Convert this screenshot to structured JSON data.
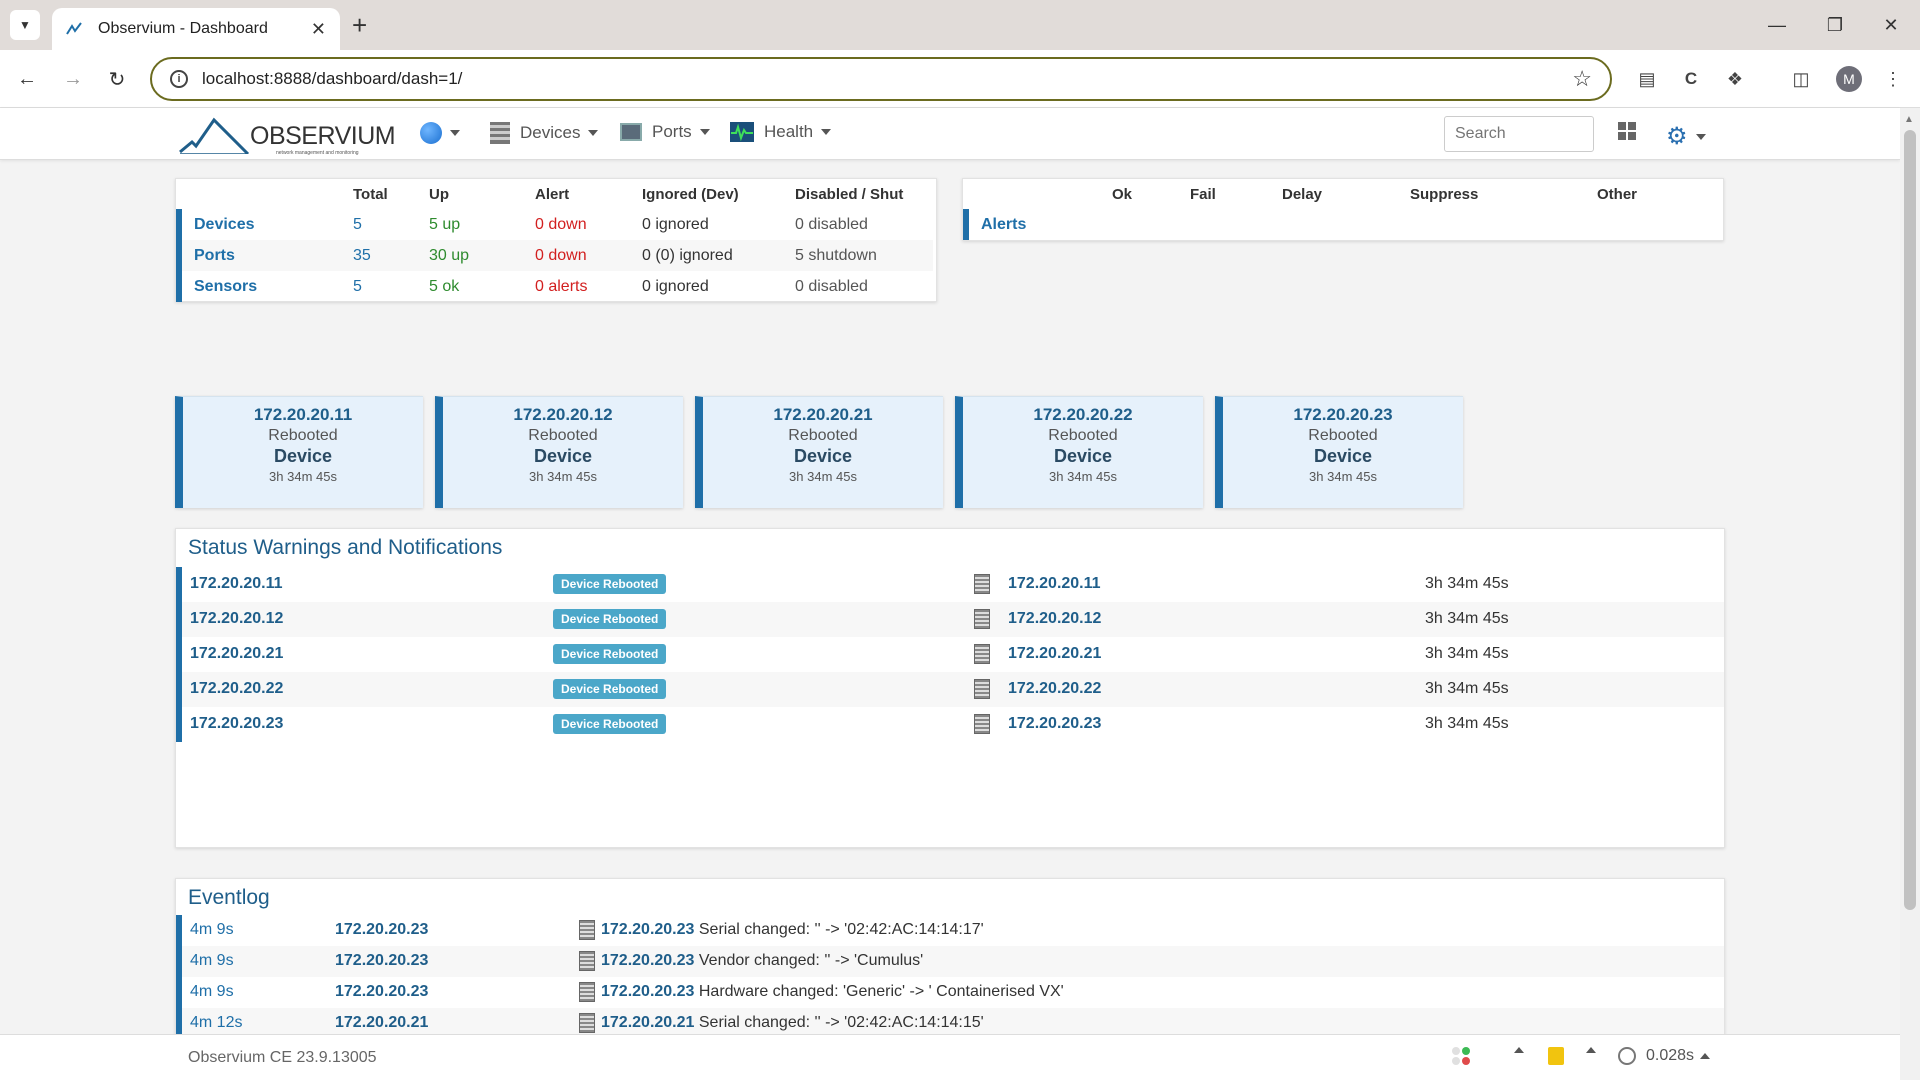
{
  "browser": {
    "tab_title": "Observium - Dashboard",
    "url": "localhost:8888/dashboard/dash=1/",
    "avatar_letter": "M"
  },
  "nav": {
    "logo_text": "OBSERVIUM",
    "logo_tagline": "network management and monitoring",
    "devices": "Devices",
    "ports": "Ports",
    "health": "Health",
    "search_placeholder": "Search"
  },
  "status_summary": {
    "headers": [
      "",
      "Total",
      "Up",
      "Alert",
      "Ignored (Dev)",
      "Disabled / Shut"
    ],
    "rows": [
      {
        "label": "Devices",
        "total": "5",
        "up": "5 up",
        "alert": "0 down",
        "ignored": "0 ignored",
        "disabled": "0 disabled"
      },
      {
        "label": "Ports",
        "total": "35",
        "up": "30 up",
        "alert": "0 down",
        "ignored": "0 (0) ignored",
        "disabled": "5 shutdown"
      },
      {
        "label": "Sensors",
        "total": "5",
        "up": "5 ok",
        "alert": "0 alerts",
        "ignored": "0 ignored",
        "disabled": "0 disabled"
      }
    ]
  },
  "alerts_summary": {
    "headers": [
      "",
      "Ok",
      "Fail",
      "Delay",
      "Suppress",
      "Other"
    ],
    "label": "Alerts"
  },
  "tiles": [
    {
      "ip": "172.20.20.11",
      "status": "Rebooted",
      "type": "Device",
      "time": "3h 34m 45s"
    },
    {
      "ip": "172.20.20.12",
      "status": "Rebooted",
      "type": "Device",
      "time": "3h 34m 45s"
    },
    {
      "ip": "172.20.20.21",
      "status": "Rebooted",
      "type": "Device",
      "time": "3h 34m 45s"
    },
    {
      "ip": "172.20.20.22",
      "status": "Rebooted",
      "type": "Device",
      "time": "3h 34m 45s"
    },
    {
      "ip": "172.20.20.23",
      "status": "Rebooted",
      "type": "Device",
      "time": "3h 34m 45s"
    }
  ],
  "warnings": {
    "title": "Status Warnings and Notifications",
    "rows": [
      {
        "host": "172.20.20.11",
        "badge": "Device Rebooted",
        "device": "172.20.20.11",
        "time": "3h 34m 45s"
      },
      {
        "host": "172.20.20.12",
        "badge": "Device Rebooted",
        "device": "172.20.20.12",
        "time": "3h 34m 45s"
      },
      {
        "host": "172.20.20.21",
        "badge": "Device Rebooted",
        "device": "172.20.20.21",
        "time": "3h 34m 45s"
      },
      {
        "host": "172.20.20.22",
        "badge": "Device Rebooted",
        "device": "172.20.20.22",
        "time": "3h 34m 45s"
      },
      {
        "host": "172.20.20.23",
        "badge": "Device Rebooted",
        "device": "172.20.20.23",
        "time": "3h 34m 45s"
      }
    ]
  },
  "eventlog": {
    "title": "Eventlog",
    "rows": [
      {
        "time": "4m 9s",
        "host": "172.20.20.23",
        "msg_host": "172.20.20.23",
        "msg": "Serial changed: '' -> '02:42:AC:14:14:17'"
      },
      {
        "time": "4m 9s",
        "host": "172.20.20.23",
        "msg_host": "172.20.20.23",
        "msg": "Vendor changed: '' -> 'Cumulus'"
      },
      {
        "time": "4m 9s",
        "host": "172.20.20.23",
        "msg_host": "172.20.20.23",
        "msg": "Hardware changed: 'Generic' -> ' Containerised VX'"
      },
      {
        "time": "4m 12s",
        "host": "172.20.20.21",
        "msg_host": "172.20.20.21",
        "msg": "Serial changed: '' -> '02:42:AC:14:14:15'"
      }
    ]
  },
  "footer": {
    "version": "Observium CE 23.9.13005",
    "timing": "0.028s"
  },
  "colors": {
    "accent": "#1f6fa8",
    "badge": "#4ba7c9",
    "ok": "#2e8b2e",
    "alert": "#d21f1f"
  }
}
